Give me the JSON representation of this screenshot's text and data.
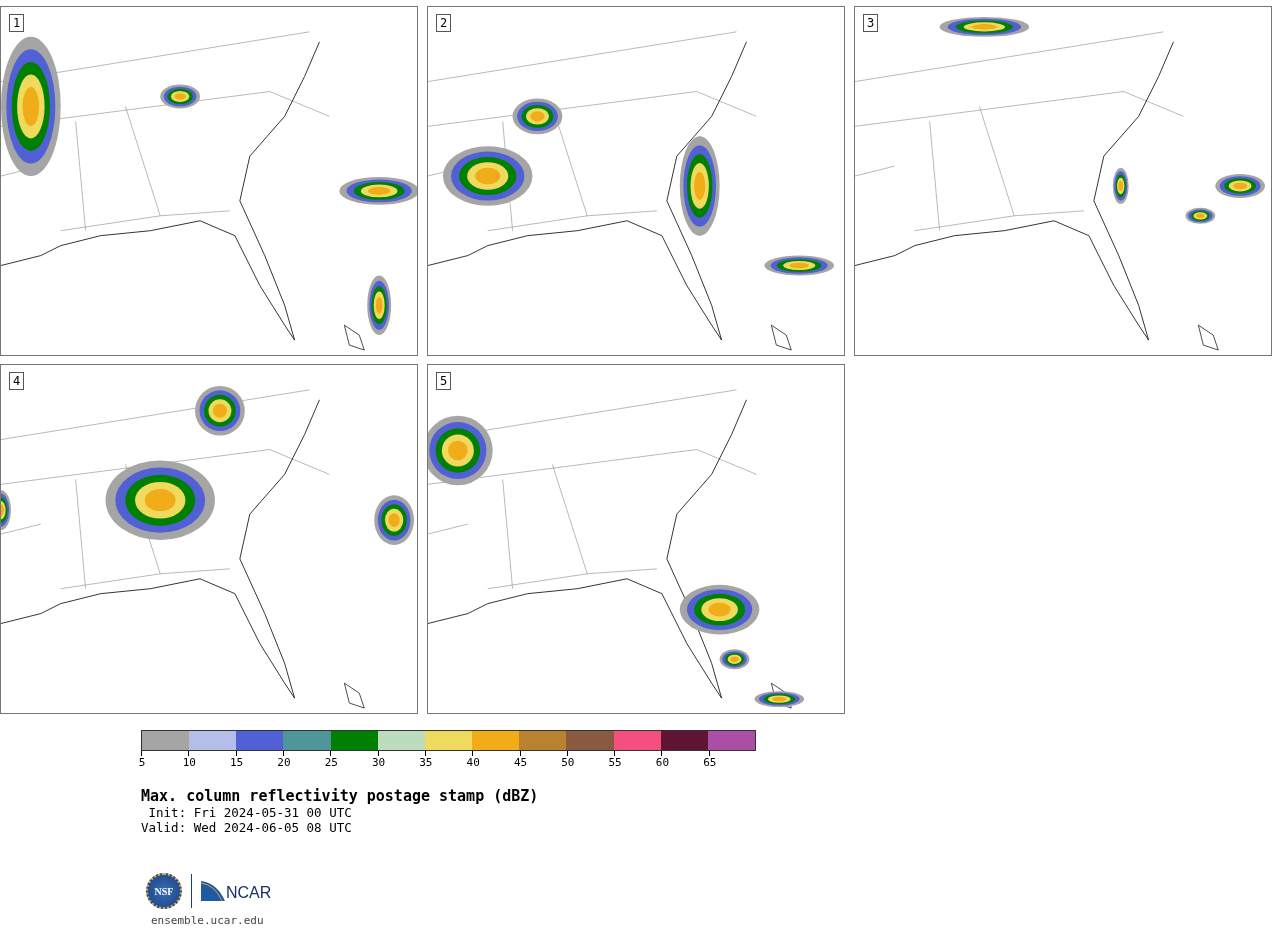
{
  "panels": [
    {
      "label": "1"
    },
    {
      "label": "2"
    },
    {
      "label": "3"
    },
    {
      "label": "4"
    },
    {
      "label": "5"
    }
  ],
  "colorbar": {
    "swatches": [
      {
        "color": "#a5a5a5"
      },
      {
        "color": "#b4bfe9"
      },
      {
        "color": "#5160d4"
      },
      {
        "color": "#4e9699"
      },
      {
        "color": "#008000"
      },
      {
        "color": "#bcdcbc"
      },
      {
        "color": "#f0da5d"
      },
      {
        "color": "#f0ac19"
      },
      {
        "color": "#b98230"
      },
      {
        "color": "#8a5a40"
      },
      {
        "color": "#f44f7f"
      },
      {
        "color": "#601434"
      },
      {
        "color": "#ab4ea6"
      }
    ],
    "ticks": [
      "5",
      "10",
      "15",
      "20",
      "25",
      "30",
      "35",
      "40",
      "45",
      "50",
      "55",
      "60",
      "65"
    ]
  },
  "title": "Max. column reflectivity postage stamp (dBZ)",
  "init": " Init: Fri 2024-05-31 00 UTC",
  "valid": "Valid: Wed 2024-06-05 08 UTC",
  "logo": {
    "nsf": "NSF",
    "ncar": "NCAR"
  },
  "site": "ensemble.ucar.edu"
}
